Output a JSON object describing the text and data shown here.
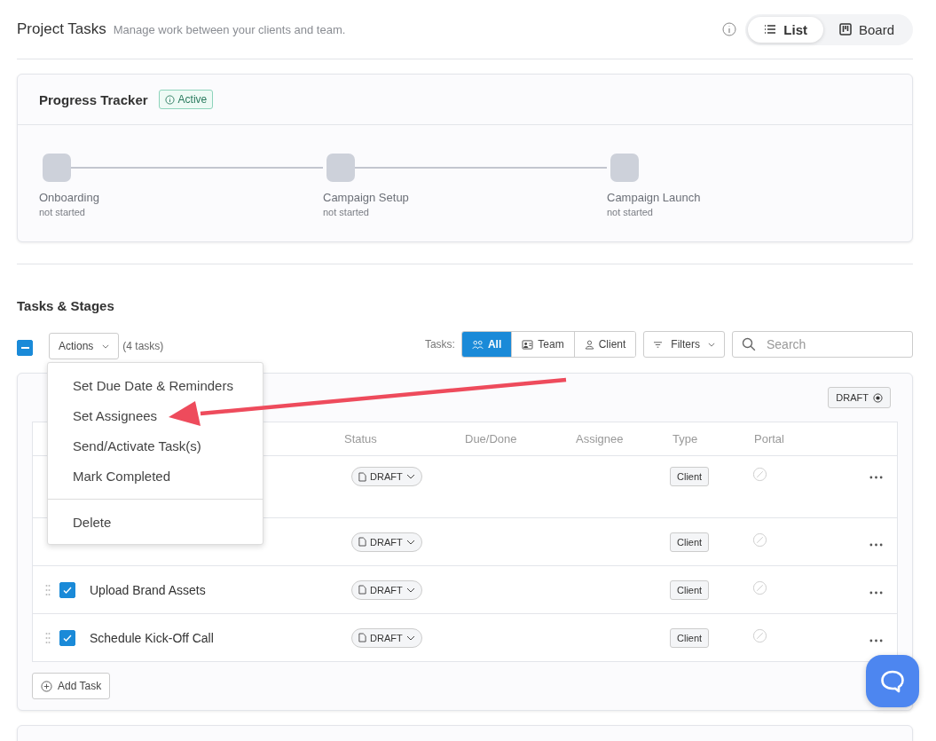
{
  "header": {
    "title": "Project Tasks",
    "subtitle": "Manage work between your clients and team.",
    "views": [
      {
        "label": "List",
        "kind": "list",
        "selected": true
      },
      {
        "label": "Board",
        "kind": "board",
        "selected": false
      }
    ]
  },
  "progress_tracker": {
    "title": "Progress Tracker",
    "badge": "Active",
    "stages": [
      {
        "name": "Onboarding",
        "status": "not started"
      },
      {
        "name": "Campaign Setup",
        "status": "not started"
      },
      {
        "name": "Campaign Launch",
        "status": "not started"
      }
    ]
  },
  "tasks_section": {
    "title": "Tasks & Stages",
    "select_all_indeterminate": true,
    "actions_label": "Actions",
    "count": "(4 tasks)",
    "filter_label": "Tasks:",
    "filters": [
      {
        "label": "All",
        "kind": "all",
        "selected": true
      },
      {
        "label": "Team",
        "kind": "team",
        "selected": false
      },
      {
        "label": "Client",
        "kind": "client",
        "selected": false
      }
    ],
    "filters_button": "Filters",
    "search": {
      "placeholder": "Search"
    },
    "actions_menu": [
      {
        "label": "Set Due Date & Reminders",
        "kind": "item"
      },
      {
        "label": "Set Assignees",
        "kind": "item"
      },
      {
        "label": "Send/Activate Task(s)",
        "kind": "item"
      },
      {
        "label": "Mark Completed",
        "kind": "item"
      },
      {
        "label": "Delete",
        "kind": "separated"
      }
    ]
  },
  "stage": {
    "badge": "DRAFT",
    "columns": [
      "Status",
      "Due/Done",
      "Assignee",
      "Type",
      "Portal"
    ],
    "tasks": [
      {
        "status": "DRAFT",
        "type": "Client",
        "tall": true
      },
      {
        "status": "DRAFT",
        "type": "Client",
        "tall": false
      },
      {
        "name": "Upload Brand Assets",
        "checked": true,
        "status": "DRAFT",
        "type": "Client",
        "tall": false
      },
      {
        "name": "Schedule Kick-Off Call",
        "checked": true,
        "status": "DRAFT",
        "type": "Client",
        "tall": false
      }
    ],
    "add_task": "Add Task"
  }
}
